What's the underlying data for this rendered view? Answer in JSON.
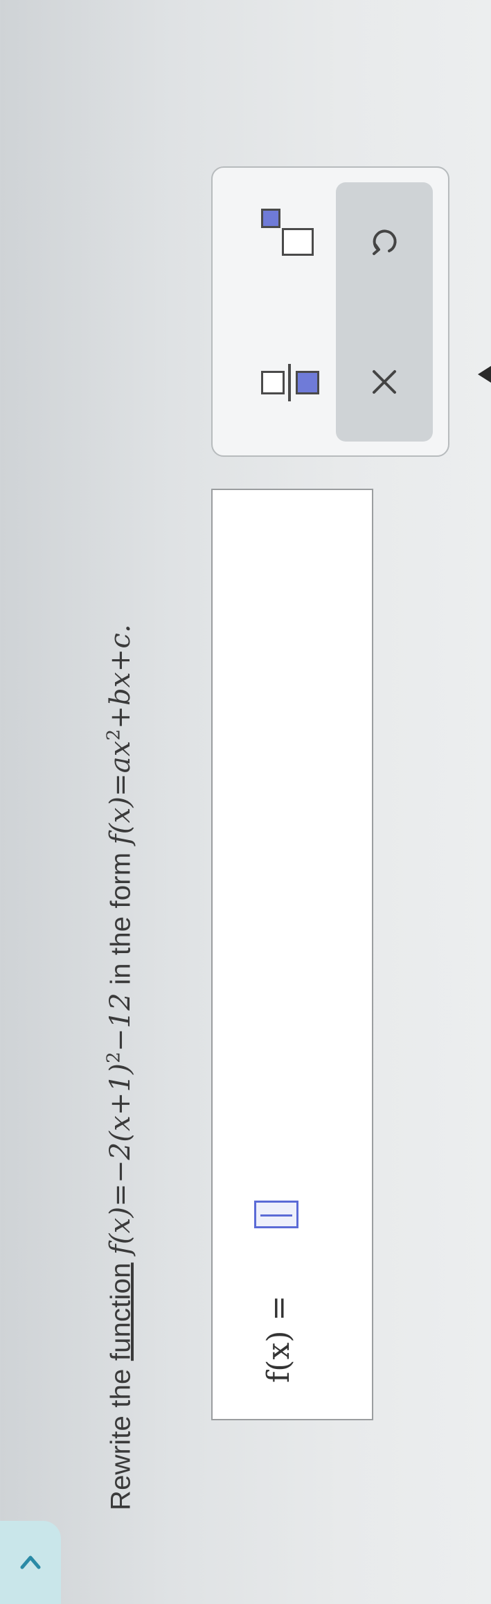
{
  "question": {
    "prefix": "Rewrite the",
    "link_text": "function",
    "given": "f(x)=−2(x+1)",
    "given_exp": "2",
    "given_tail": "−12",
    "middle": "in the form",
    "form_head": "f(x)=ax",
    "form_exp": "2",
    "form_tail": "+bx+c."
  },
  "answer": {
    "label": "f(x) ="
  },
  "icons": {
    "nav": "chevron-right-icon",
    "fraction": "fraction-template-icon",
    "power": "exponent-template-icon",
    "clear": "close-icon",
    "undo": "undo-icon"
  },
  "colors": {
    "accent": "#5b6bd6",
    "nav_bg": "#c9e6ea"
  }
}
